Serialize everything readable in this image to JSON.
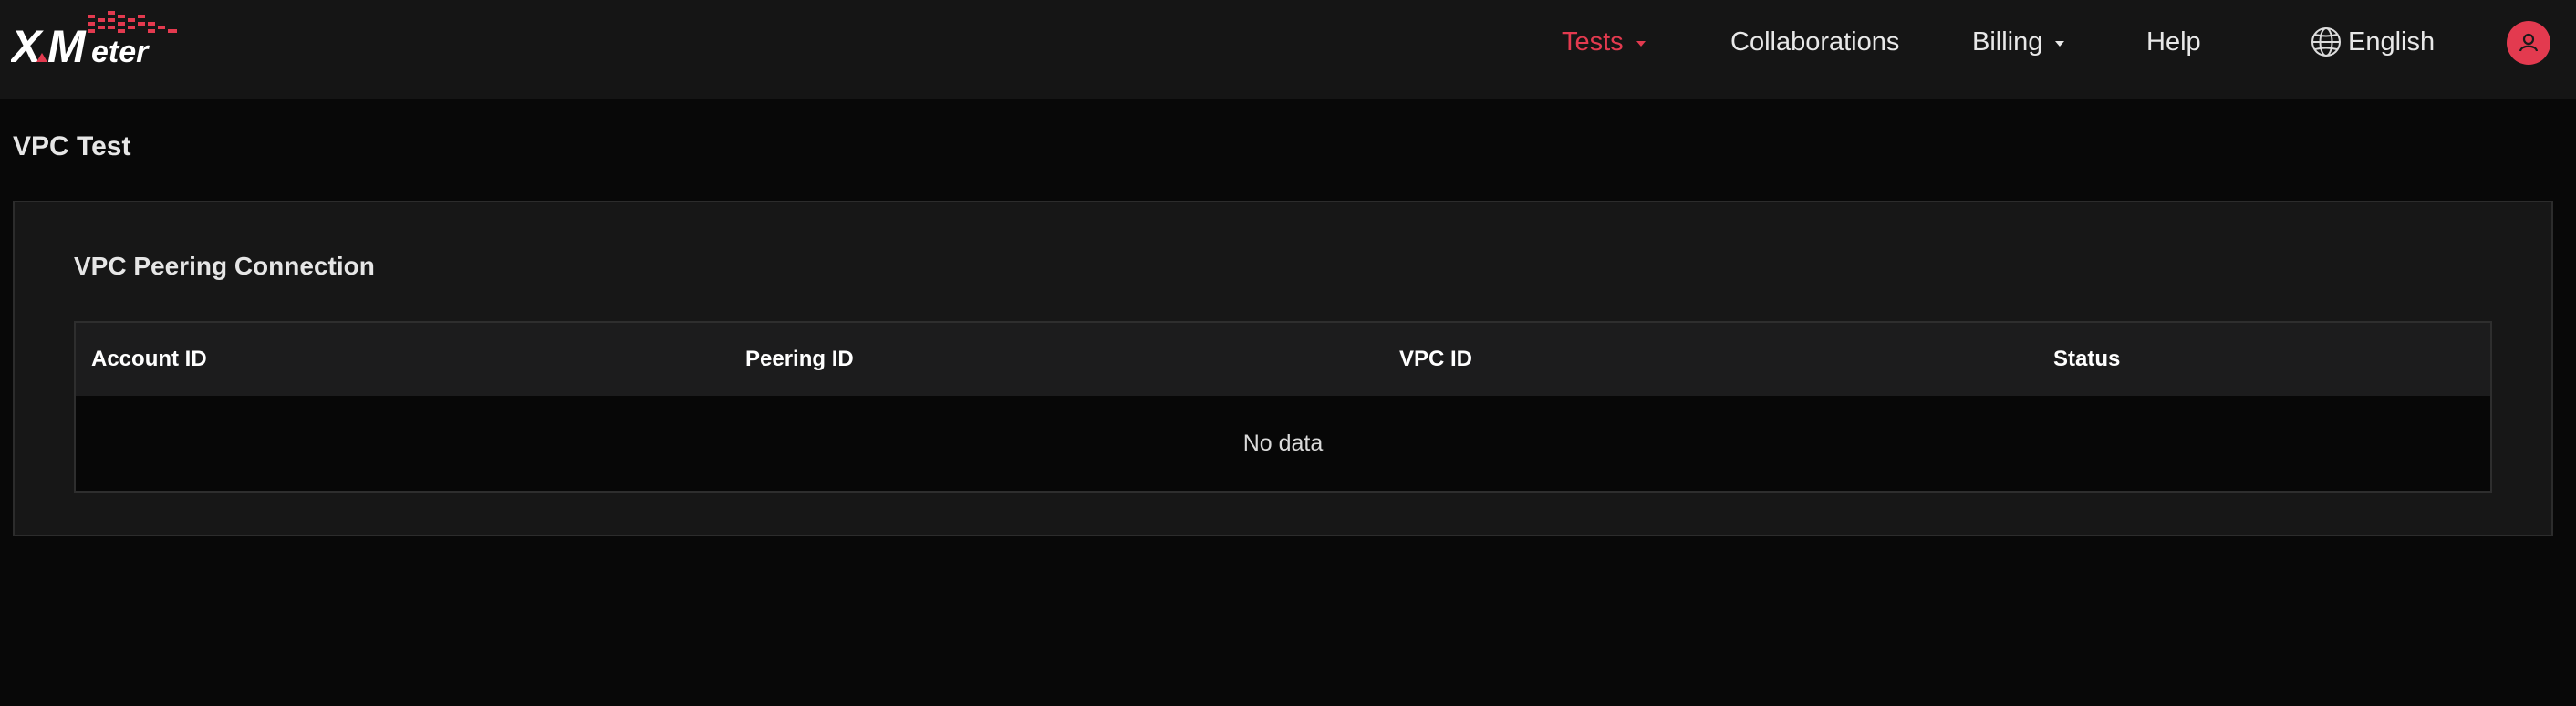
{
  "app": {
    "logo_text": "XMeter",
    "brand_color": "#e33a4f"
  },
  "nav": {
    "tests": "Tests",
    "collaborations": "Collaborations",
    "billing": "Billing",
    "help": "Help",
    "language": "English"
  },
  "page": {
    "title": "VPC Test"
  },
  "card": {
    "title": "VPC Peering Connection",
    "table": {
      "columns": [
        "Account ID",
        "Peering ID",
        "VPC ID",
        "Status"
      ],
      "rows": [],
      "empty_text": "No data"
    }
  },
  "icons": {
    "language": "globe-icon",
    "user": "user-icon",
    "dropdown": "caret-down-icon"
  }
}
